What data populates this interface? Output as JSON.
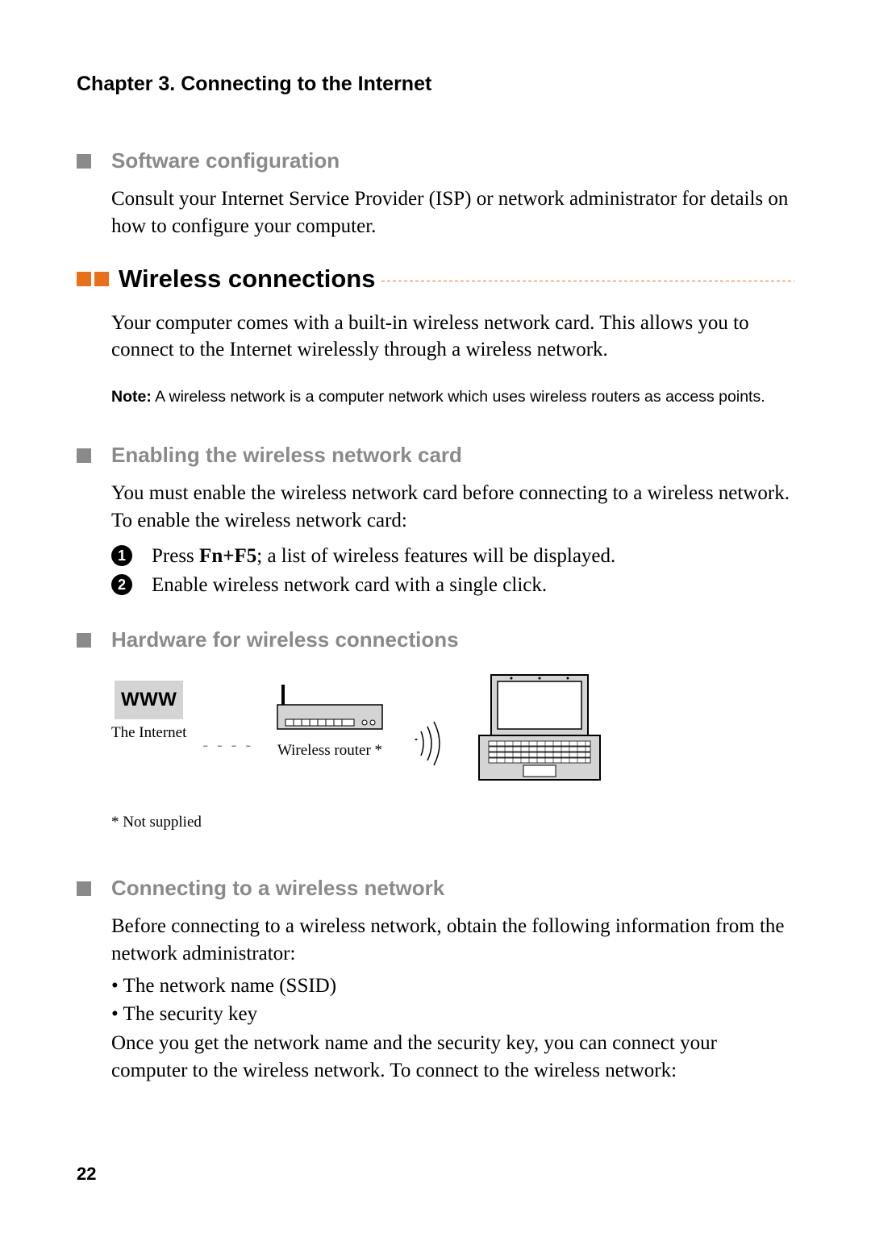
{
  "chapter": "Chapter 3. Connecting to the Internet",
  "sections": {
    "software_config": {
      "title": "Software configuration",
      "body": "Consult your Internet Service Provider (ISP) or network administrator for details on how to configure your computer."
    },
    "wireless": {
      "title": "Wireless connections",
      "intro": "Your computer comes with a built-in wireless network card. This allows you to connect to the Internet wirelessly through a wireless network.",
      "note_label": "Note:",
      "note_text": " A wireless network is a computer network which uses wireless routers as access points."
    },
    "enabling": {
      "title": "Enabling the wireless network card",
      "intro": "You must enable the wireless network card before connecting to a wireless network. To enable the wireless network card:",
      "step1_pre": "Press ",
      "step1_bold": "Fn+F5",
      "step1_post": "; a list of wireless features will be displayed.",
      "step2": "Enable wireless network card with a single click."
    },
    "hardware": {
      "title": "Hardware for wireless connections",
      "www_label": "WWW",
      "internet_caption": "The Internet",
      "router_caption": "Wireless router *",
      "footnote": "* Not supplied"
    },
    "connecting": {
      "title": "Connecting to a wireless network",
      "intro": "Before connecting to a wireless network, obtain the following information from the network administrator:",
      "bullet1": "• The network name (SSID)",
      "bullet2": "• The security key",
      "outro": "Once you get the network name and the security key, you can connect your computer to the wireless network. To connect to the wireless network:"
    }
  },
  "page_number": "22"
}
